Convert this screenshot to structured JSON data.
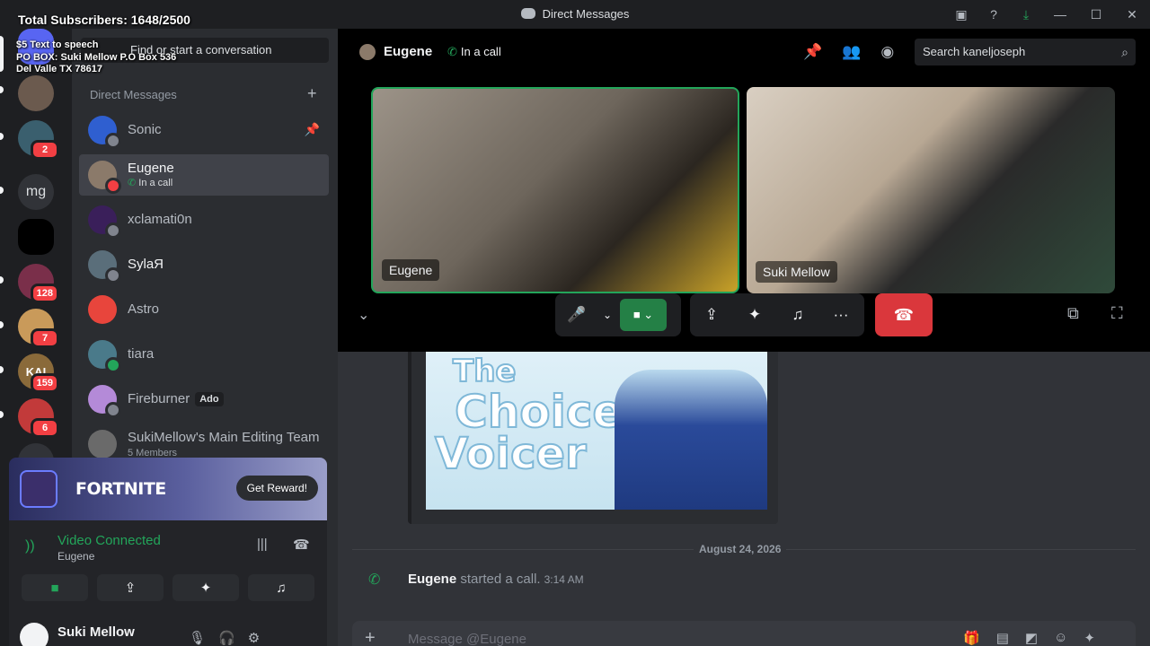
{
  "overlay": {
    "subscribers": "Total Subscribers: 1648/2500",
    "tts_line1": "$5 Text to speech",
    "tts_line2": "PO BOX: Suki Mellow P.O Box 536",
    "tts_line3": "Del Valle TX 78617"
  },
  "titlebar": {
    "title": "Direct Messages",
    "icons": [
      "inbox-icon",
      "help-icon",
      "download-icon"
    ],
    "window_controls": [
      "minimize",
      "maximize",
      "close"
    ]
  },
  "rail": {
    "servers": [
      {
        "name": "dm-home",
        "color": "#5865f2"
      },
      {
        "name": "avatar-1",
        "color": "#6b5a4e"
      },
      {
        "name": "avatar-2",
        "color": "#3a5f6e",
        "badge": "2"
      },
      {
        "name": "mg",
        "text": "mg"
      },
      {
        "name": "black-server",
        "color": "#000000"
      },
      {
        "name": "avatar-3",
        "color": "#7a2f4a",
        "badge": "128"
      },
      {
        "name": "avatar-4",
        "color": "#c99a5a",
        "badge": "7"
      },
      {
        "name": "avatar-5",
        "color": "#8a6a3a",
        "badge": "159",
        "text": "KAI"
      },
      {
        "name": "avatar-6",
        "color": "#c23a3a",
        "badge": "6"
      }
    ]
  },
  "sidebar": {
    "find_placeholder": "Find or start a conversation",
    "section_title": "Direct Messages",
    "dms": [
      {
        "name": "Sonic",
        "color": "#2f5fd0",
        "status": "#80848e",
        "pinned": true
      },
      {
        "name": "Eugene",
        "sub": "In a call",
        "color": "#8b7a6a",
        "status": "#f23f43",
        "active": true
      },
      {
        "name": "xclamati0n",
        "color": "#3a1f5a",
        "status": "#80848e"
      },
      {
        "name": "SylaЯ",
        "color": "#5a6e7a",
        "status": "#80848e",
        "unread": true
      },
      {
        "name": "Astro",
        "color": "#e8453c",
        "status": null
      },
      {
        "name": "tiara",
        "color": "#4a7a8a",
        "status": "#23a55a"
      },
      {
        "name": "Fireburner",
        "tag": "Ado",
        "color": "#b48ad8",
        "status": "#80848e"
      },
      {
        "name": "SukiMellow's Main Editing Team",
        "sub": "5 Members",
        "color": "#6a6a6a",
        "status": null
      }
    ]
  },
  "promo": {
    "title": "FORTNITE",
    "button": "Get Reward!"
  },
  "voice": {
    "title": "Video Connected",
    "subtitle": "Eugene"
  },
  "user": {
    "name": "Suki Mellow"
  },
  "header": {
    "name": "Eugene",
    "status": "In a call",
    "search_placeholder": "Search kaneljoseph"
  },
  "call": {
    "tiles": [
      {
        "label": "Eugene",
        "color": "#8a7f72",
        "border": "#23a55a"
      },
      {
        "label": "Suki Mellow",
        "color": "#cdbfae",
        "border": null
      }
    ]
  },
  "chat": {
    "embed_title_line1": "The",
    "embed_title_line2": "Choicer",
    "embed_title_line3": "Voicer",
    "divider_date": "August 24, 2026",
    "system_user": "Eugene",
    "system_text": "started a call.",
    "system_time": "3:14 AM",
    "composer_placeholder": "Message @Eugene"
  }
}
